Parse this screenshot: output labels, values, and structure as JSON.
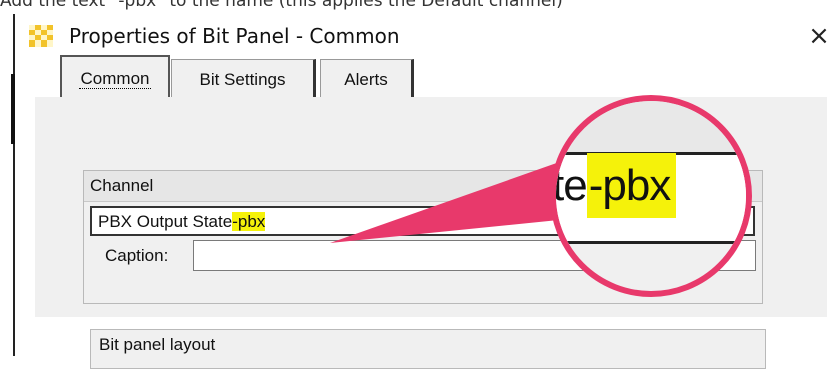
{
  "instruction": "Add the text \"-pbx\" to the name (this applies the Default channel)",
  "window": {
    "title": "Properties of Bit Panel - Common",
    "close_glyph": "×"
  },
  "tabs": [
    {
      "label": "Common",
      "active": true
    },
    {
      "label": "Bit Settings",
      "active": false
    },
    {
      "label": "Alerts",
      "active": false
    }
  ],
  "channel_group": {
    "label": "Channel",
    "selected_value_prefix": "PBX Output State",
    "selected_value_suffix": "-pbx",
    "caption_label": "Caption:",
    "caption_value": ""
  },
  "layout_group": {
    "label": "Bit panel layout"
  },
  "magnifier": {
    "text_prefix": "te",
    "text_highlight": "-pbx"
  },
  "colors": {
    "highlight": "#f5f20a",
    "callout": "#e8396b",
    "dialog_bg": "#f0f0f0"
  },
  "icons": {
    "app": "app-icon",
    "close": "close-icon",
    "dropdown": "chevron-down-icon"
  }
}
